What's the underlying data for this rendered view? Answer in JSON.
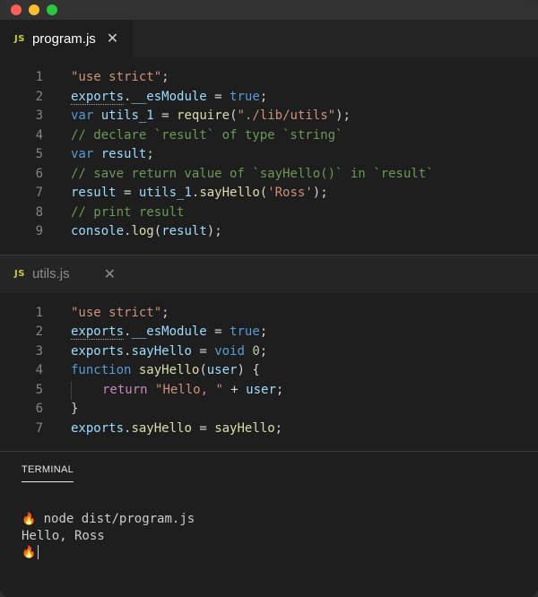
{
  "tabs": {
    "program": {
      "icon_label": "JS",
      "name": "program.js",
      "close": "✕"
    },
    "utils": {
      "icon_label": "JS",
      "name": "utils.js",
      "close": "✕"
    }
  },
  "program_code": {
    "l1": "1",
    "l2": "2",
    "l3": "3",
    "l4": "4",
    "l5": "5",
    "l6": "6",
    "l7": "7",
    "l8": "8",
    "l9": "9",
    "t1": "\"use strict\"",
    "t2a": "exports",
    "t2b": "__esModule",
    "t2c": "true",
    "t3a": "var",
    "t3b": "utils_1",
    "t3c": "require",
    "t3d": "\"./lib/utils\"",
    "t4": "// declare `result` of type `string`",
    "t5a": "var",
    "t5b": "result",
    "t6": "// save return value of `sayHello()` in `result`",
    "t7a": "result",
    "t7b": "utils_1",
    "t7c": "sayHello",
    "t7d": "'Ross'",
    "t8": "// print result",
    "t9a": "console",
    "t9b": "log",
    "t9c": "result"
  },
  "utils_code": {
    "l1": "1",
    "l2": "2",
    "l3": "3",
    "l4": "4",
    "l5": "5",
    "l6": "6",
    "l7": "7",
    "t1": "\"use strict\"",
    "t2a": "exports",
    "t2b": "__esModule",
    "t2c": "true",
    "t3a": "exports",
    "t3b": "sayHello",
    "t3c": "void",
    "t3d": "0",
    "t4a": "function",
    "t4b": "sayHello",
    "t4c": "user",
    "t5a": "return",
    "t5b": "\"Hello, \"",
    "t5c": "user",
    "t6": "}",
    "t7a": "exports",
    "t7b": "sayHello",
    "t7c": "sayHello"
  },
  "terminal": {
    "tab_label": "TERMINAL",
    "prompt": "🔥",
    "command": " node dist/program.js",
    "output": "Hello, Ross"
  }
}
